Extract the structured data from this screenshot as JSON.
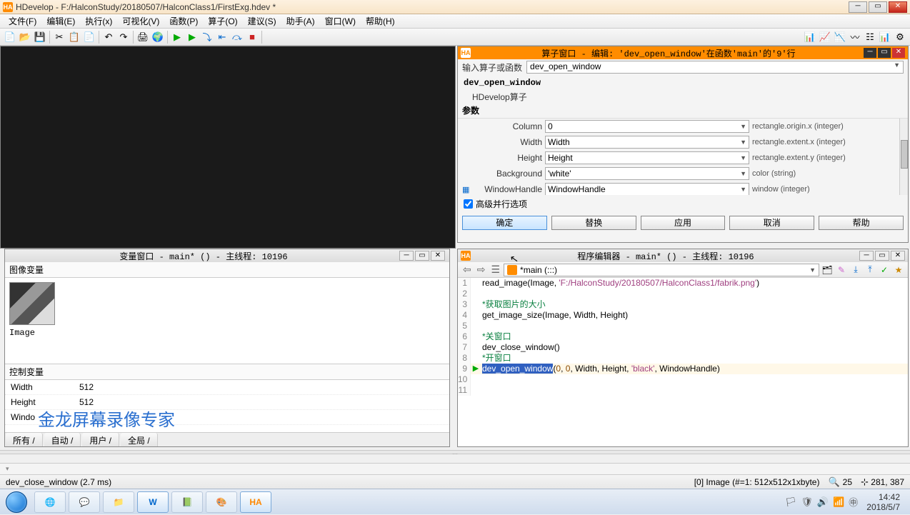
{
  "titlebar": {
    "app_icon": "HA",
    "title": "HDevelop - F:/HalconStudy/20180507/HalconClass1/FirstExg.hdev *"
  },
  "menu": {
    "file": "文件(F)",
    "edit": "编辑(E)",
    "execute": "执行(x)",
    "visualize": "可视化(V)",
    "function": "函数(P)",
    "operator": "算子(O)",
    "suggest": "建议(S)",
    "assistant": "助手(A)",
    "window": "窗口(W)",
    "help": "帮助(H)"
  },
  "opdialog": {
    "title": "算子窗口 - 编辑: 'dev_open_window'在函数'main'的'9'行",
    "input_label": "输入算子或函数",
    "input_value": "dev_open_window",
    "op_name": "dev_open_window",
    "op_kind": "HDevelop算子",
    "params_label": "参数",
    "params": [
      {
        "icon": "",
        "name": "Column",
        "value": "0",
        "type": "rectangle.origin.x (integer)"
      },
      {
        "icon": "",
        "name": "Width",
        "value": "Width",
        "type": "rectangle.extent.x (integer)"
      },
      {
        "icon": "",
        "name": "Height",
        "value": "Height",
        "type": "rectangle.extent.y (integer)"
      },
      {
        "icon": "",
        "name": "Background",
        "value": "'white'",
        "type": "color (string)"
      },
      {
        "icon": "▦",
        "name": "WindowHandle",
        "value": "WindowHandle",
        "type": "window (integer)"
      }
    ],
    "advanced_label": "高级并行选项",
    "ok": "确定",
    "replace": "替换",
    "apply": "应用",
    "cancel": "取消",
    "help": "帮助"
  },
  "varwin": {
    "title": "变量窗口 - main* () - 主线程: 10196",
    "image_section": "图像变量",
    "image_name": "Image",
    "ctrl_section": "控制变量",
    "vars": [
      {
        "name": "Width",
        "value": "512"
      },
      {
        "name": "Height",
        "value": "512"
      },
      {
        "name": "Windo",
        "value": ""
      }
    ],
    "watermark": "金龙屏幕录像专家",
    "tabs": {
      "all": "所有 /",
      "auto": "自动 /",
      "user": "用户 /",
      "global": "全局 /"
    }
  },
  "progwin": {
    "title": "程序编辑器 - main* () - 主线程: 10196",
    "func_selector": "*main (:::)",
    "code": [
      {
        "n": 1,
        "arrow": "",
        "html": "<span class='c-func'>read_image</span>(Image, <span class='c-str'>'F:/HalconStudy/20180507/HalconClass1/fabrik.png'</span>)"
      },
      {
        "n": 2,
        "arrow": "",
        "html": ""
      },
      {
        "n": 3,
        "arrow": "",
        "html": "<span class='c-comment'>*获取图片的大小</span>"
      },
      {
        "n": 4,
        "arrow": "",
        "html": "<span class='c-func'>get_image_size</span>(Image, Width, Height)"
      },
      {
        "n": 5,
        "arrow": "",
        "html": ""
      },
      {
        "n": 6,
        "arrow": "",
        "html": "<span class='c-comment'>*关窗口</span>"
      },
      {
        "n": 7,
        "arrow": "",
        "html": "<span class='c-func'>dev_close_window</span>()"
      },
      {
        "n": 8,
        "arrow": "",
        "html": "<span class='c-comment'>*开窗口</span>"
      },
      {
        "n": 9,
        "arrow": "▶",
        "html": "<span class='c-sel'>dev_open_window</span>(<span class='c-num'>0</span>, <span class='c-num'>0</span>, Width, Height, <span class='c-str'>'black'</span>, WindowHandle)",
        "current": true
      },
      {
        "n": 10,
        "arrow": "",
        "html": ""
      },
      {
        "n": 11,
        "arrow": "",
        "html": ""
      }
    ]
  },
  "status": {
    "left": "dev_close_window (2.7 ms)",
    "image_info": "[0] Image (#=1: 512x512x1xbyte)",
    "zoom": "25",
    "coords": "281, 387"
  },
  "clock": {
    "time": "14:42",
    "date": "2018/5/7"
  }
}
